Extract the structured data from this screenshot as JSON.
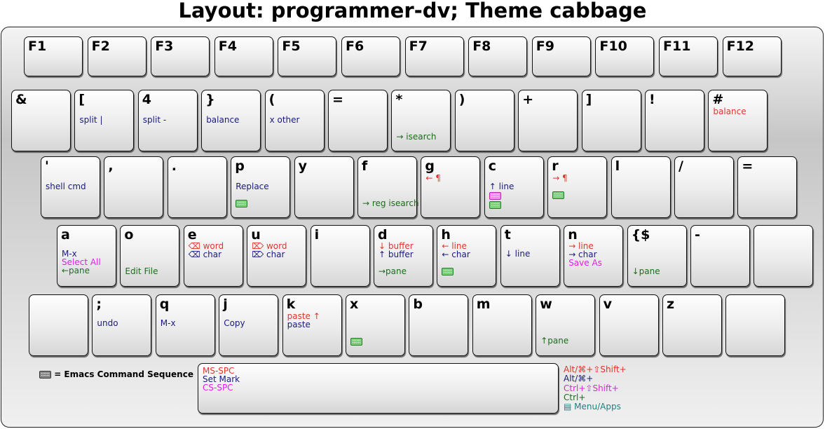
{
  "title": "Layout: programmer-dv; Theme cabbage",
  "legend": "= Emacs Command Sequence",
  "modifiers": [
    {
      "text": "Alt/⌘+⇧Shift+",
      "color": "red"
    },
    {
      "text": "Alt/⌘+",
      "color": "darkblue"
    },
    {
      "text": "Ctrl+⇧Shift+",
      "color": "magenta"
    },
    {
      "text": "Ctrl+",
      "color": "green"
    },
    {
      "text": "▤ Menu/Apps",
      "color": "teal"
    }
  ],
  "rows": [
    [
      {
        "label": "F1"
      },
      {
        "label": "F2"
      },
      {
        "label": "F3"
      },
      {
        "label": "F4"
      },
      {
        "label": "F5"
      },
      {
        "label": "F6"
      },
      {
        "label": "F7"
      },
      {
        "label": "F8"
      },
      {
        "label": "F9"
      },
      {
        "label": "F10"
      },
      {
        "label": "F11"
      },
      {
        "label": "F12"
      }
    ],
    [
      {
        "label": "&"
      },
      {
        "label": "[",
        "lines": [
          {
            "text": "split |",
            "color": "darkblue"
          }
        ]
      },
      {
        "label": "4",
        "lines": [
          {
            "text": "split -",
            "color": "darkblue"
          }
        ]
      },
      {
        "label": "}",
        "lines": [
          {
            "text": "balance",
            "color": "darkblue"
          }
        ]
      },
      {
        "label": "(",
        "lines": [
          {
            "text": "x other",
            "color": "darkblue"
          }
        ]
      },
      {
        "label": "="
      },
      {
        "label": "*",
        "lines": [
          {
            "text": "→ isearch",
            "color": "green"
          }
        ]
      },
      {
        "label": ")"
      },
      {
        "label": "+"
      },
      {
        "label": "]"
      },
      {
        "label": "!"
      },
      {
        "label": "#",
        "lines": [
          {
            "text": "balance",
            "color": "red"
          }
        ]
      }
    ],
    [
      {
        "label": "'",
        "lines": [
          {
            "text": "shell cmd",
            "color": "darkblue"
          }
        ]
      },
      {
        "label": ","
      },
      {
        "label": "."
      },
      {
        "label": "p",
        "lines": [
          {
            "text": "Replace",
            "color": "darkblue"
          },
          {
            "text": "",
            "color": "green",
            "icon": "green"
          }
        ]
      },
      {
        "label": "y"
      },
      {
        "label": "f",
        "lines": [
          {
            "text": "→ reg isearch",
            "color": "green"
          }
        ]
      },
      {
        "label": "g",
        "lines": [
          {
            "text": "← ¶",
            "color": "red"
          }
        ]
      },
      {
        "label": "c",
        "lines": [
          {
            "text": "↑ line",
            "color": "darkblue"
          },
          {
            "text": "",
            "color": "magenta",
            "icon": "pink"
          },
          {
            "text": "",
            "color": "green",
            "icon": "green"
          }
        ]
      },
      {
        "label": "r",
        "lines": [
          {
            "text": "→ ¶",
            "color": "red"
          },
          {
            "text": "",
            "color": "green",
            "icon": "green"
          }
        ]
      },
      {
        "label": "l"
      },
      {
        "label": "/"
      },
      {
        "label": "="
      }
    ],
    [
      {
        "label": "a",
        "lines": [
          {
            "text": "M-x",
            "color": "darkblue"
          },
          {
            "text": "Select All",
            "color": "magenta"
          },
          {
            "text": "←pane",
            "color": "green"
          }
        ]
      },
      {
        "label": "o",
        "lines": [
          {
            "text": "Edit File",
            "color": "green"
          }
        ]
      },
      {
        "label": "e",
        "lines": [
          {
            "text": "⌫ word",
            "color": "red"
          },
          {
            "text": "⌫ char",
            "color": "darkblue"
          }
        ]
      },
      {
        "label": "u",
        "lines": [
          {
            "text": "⌦ word",
            "color": "red"
          },
          {
            "text": "⌦ char",
            "color": "darkblue"
          }
        ]
      },
      {
        "label": "i"
      },
      {
        "label": "d",
        "lines": [
          {
            "text": "↓ buffer",
            "color": "red"
          },
          {
            "text": "↑ buffer",
            "color": "darkblue"
          },
          {
            "text": "→pane",
            "color": "green"
          }
        ]
      },
      {
        "label": "h",
        "lines": [
          {
            "text": "← line",
            "color": "red"
          },
          {
            "text": "← char",
            "color": "darkblue"
          },
          {
            "text": "",
            "color": "green",
            "icon": "green"
          }
        ]
      },
      {
        "label": "t",
        "lines": [
          {
            "text": "↓ line",
            "color": "darkblue"
          }
        ]
      },
      {
        "label": "n",
        "lines": [
          {
            "text": "→ line",
            "color": "red"
          },
          {
            "text": "→ char",
            "color": "darkblue"
          },
          {
            "text": "Save As",
            "color": "magenta"
          }
        ]
      },
      {
        "label": "{$",
        "lines": [
          {
            "text": "↓pane",
            "color": "green"
          }
        ]
      },
      {
        "label": "-"
      },
      {
        "label": ""
      }
    ],
    [
      {
        "label": ""
      },
      {
        "label": ";",
        "lines": [
          {
            "text": "undo",
            "color": "darkblue"
          }
        ]
      },
      {
        "label": "q",
        "lines": [
          {
            "text": "M-x",
            "color": "darkblue"
          }
        ]
      },
      {
        "label": "j",
        "lines": [
          {
            "text": "Copy",
            "color": "darkblue"
          }
        ]
      },
      {
        "label": "k",
        "lines": [
          {
            "text": "paste ↑",
            "color": "red"
          },
          {
            "text": "paste",
            "color": "darkblue"
          }
        ]
      },
      {
        "label": "x",
        "lines": [
          {
            "text": "",
            "color": "green",
            "icon": "green"
          }
        ]
      },
      {
        "label": "b"
      },
      {
        "label": "m"
      },
      {
        "label": "w",
        "lines": [
          {
            "text": "↑pane",
            "color": "green"
          }
        ]
      },
      {
        "label": "v"
      },
      {
        "label": "z"
      },
      {
        "label": ""
      }
    ],
    [
      {
        "label": "",
        "lines": [
          {
            "text": "MS-SPC",
            "color": "red"
          },
          {
            "text": "Set Mark",
            "color": "darkblue"
          },
          {
            "text": "CS-SPC",
            "color": "magenta"
          }
        ]
      }
    ]
  ]
}
